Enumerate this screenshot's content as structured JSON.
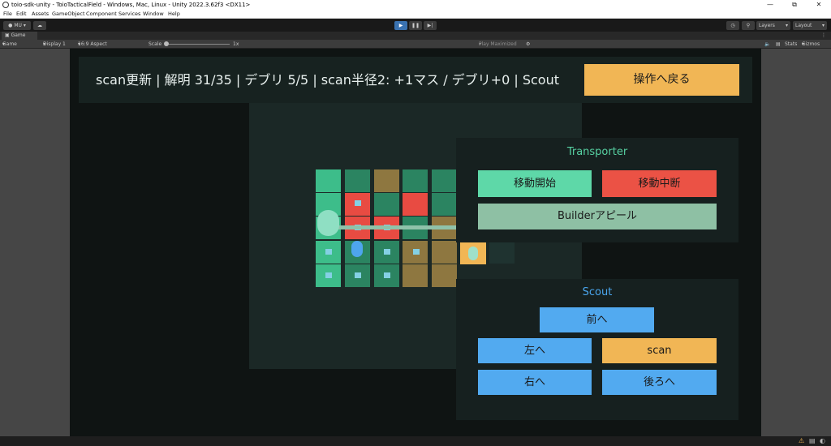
{
  "window": {
    "title": "toio-sdk-unity - ToioTacticalField - Windows, Mac, Linux - Unity 2022.3.62f3 <DX11>"
  },
  "menu": [
    "File",
    "Edit",
    "Assets",
    "GameObject",
    "Component",
    "Services",
    "Window",
    "Help"
  ],
  "toolbar": {
    "account": "MU",
    "layers": "Layers",
    "layout": "Layout"
  },
  "tab": {
    "label": "Game"
  },
  "gamebar": {
    "mode": "Game",
    "display": "Display 1",
    "aspect": "16:9 Aspect",
    "scale_label": "Scale",
    "scale_value": "1x",
    "play_mode": "Play Maximized",
    "stats": "Stats",
    "gizmos": "Gizmos"
  },
  "hud": {
    "status": "scan更新 | 解明 31/35 | デブリ 5/5 | scan半径2: +1マス / デブリ+0 | Scout",
    "back_button": "操作へ戻る"
  },
  "transporter": {
    "title": "Transporter",
    "start": "移動開始",
    "stop": "移動中断",
    "appeal": "Builderアピール"
  },
  "scout": {
    "title": "Scout",
    "forward": "前へ",
    "left": "左へ",
    "scan": "scan",
    "right": "右へ",
    "back": "後ろへ"
  },
  "colors": {
    "accent_orange": "#f1b655",
    "green_button": "#5ed8a8",
    "red_button": "#eb5245",
    "sage_button": "#8ec0a4",
    "blue_button": "#52aaf0",
    "transporter_title": "#57d1a2",
    "scout_title": "#4aa6ee"
  }
}
